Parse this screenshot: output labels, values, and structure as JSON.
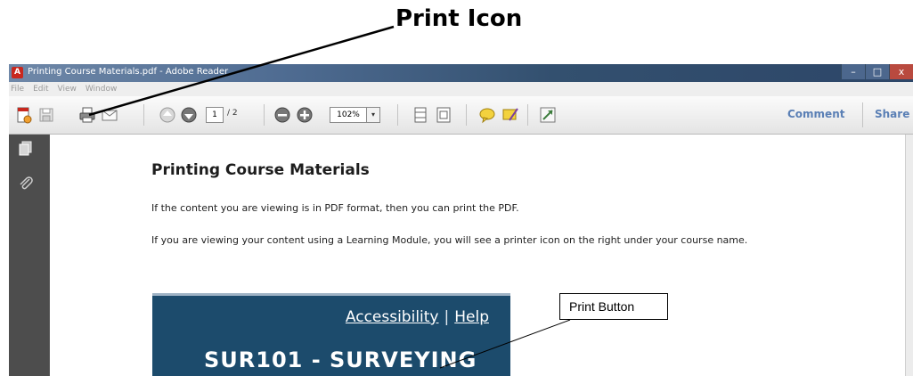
{
  "callout_title": "Print Icon",
  "window": {
    "title": "Printing Course Materials.pdf - Adobe Reader",
    "app_icon": "adobe-reader-icon",
    "controls": [
      "–",
      "□",
      "x"
    ]
  },
  "menu": [
    "File",
    "Edit",
    "View",
    "Window"
  ],
  "toolbar": {
    "page_current": "1",
    "page_total": "/ 2",
    "zoom": "102%",
    "zoom_arrow": "▾",
    "comment_label": "Comment",
    "share_label": "Share"
  },
  "document": {
    "heading": "Printing Course Materials",
    "para1": "If the content you are viewing is in PDF format, then you can print the PDF.",
    "para2": "If you are viewing your content using a Learning Module, you will see a printer icon on the right under your course name.",
    "embedded": {
      "link_accessibility": "Accessibility",
      "link_separator": "|",
      "link_help": "Help",
      "course_name": "SUR101 - SURVEYING"
    }
  },
  "print_button_callout": "Print Button",
  "colors": {
    "titlebar": "#33506f",
    "embedded_banner": "#1c4b6c",
    "link_accent": "#5a7fb5"
  }
}
